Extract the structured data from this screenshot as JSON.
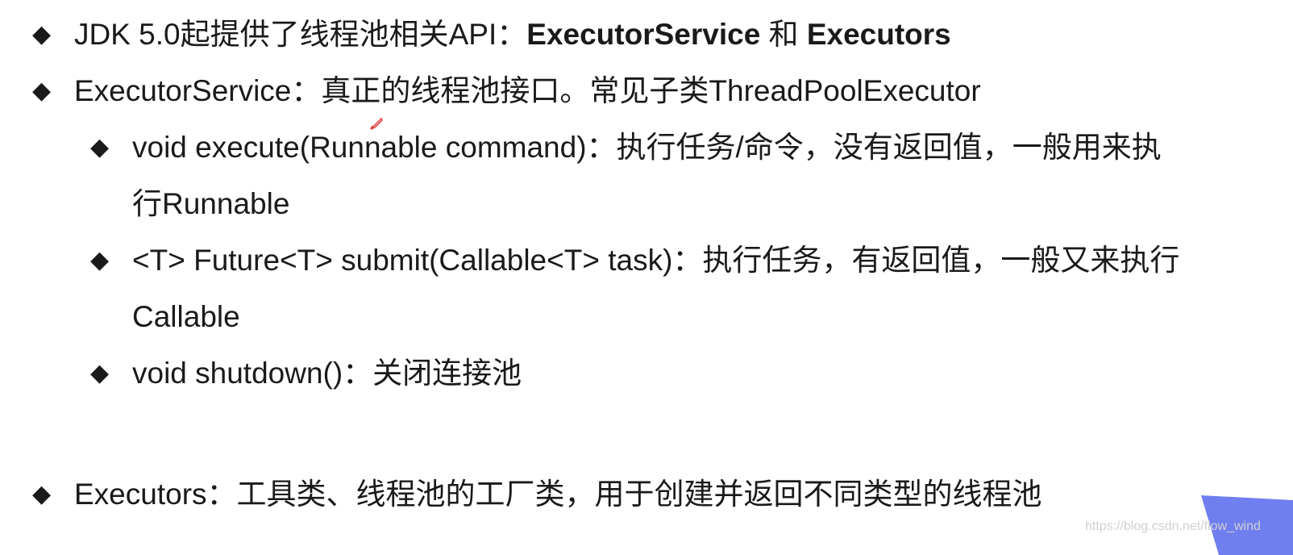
{
  "bullet_glyph": "◆",
  "bullets": {
    "b1": {
      "prefix": "JDK 5.0起提供了线程池相关API：",
      "bold1": "ExecutorService",
      "mid": " 和 ",
      "bold2": "Executors"
    },
    "b2": {
      "text": "ExecutorService：真正的线程池接口。常见子类ThreadPoolExecutor"
    },
    "s1": {
      "line1": "void execute(Runnable command)：执行任务/命令，没有返回值，一般用来执",
      "line2": "行Runnable"
    },
    "s2": {
      "line1": "<T> Future<T> submit(Callable<T> task)：执行任务，有返回值，一般又来执行",
      "line2": "Callable"
    },
    "s3": {
      "text": "void shutdown()：关闭连接池"
    },
    "b3": {
      "text": "Executors：工具类、线程池的工厂类，用于创建并返回不同类型的线程池"
    }
  },
  "watermark": "https://blog.csdn.net/flow_wind",
  "colors": {
    "text": "#1a1a1a",
    "corner_shape": "#6f7ff0",
    "annotation": "#e23a3a"
  }
}
